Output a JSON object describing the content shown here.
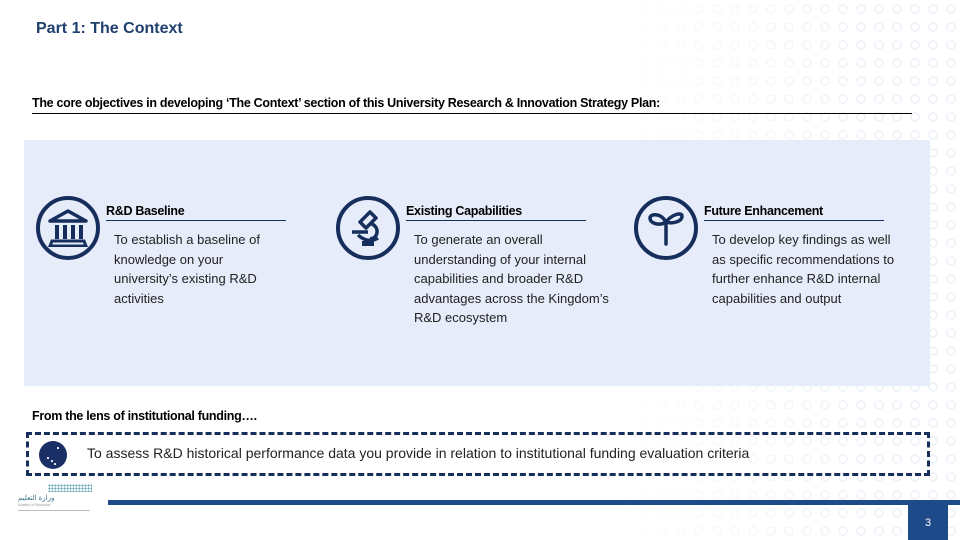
{
  "header": {
    "title": "Part 1: The Context",
    "subtitle": "The core objectives in developing ‘The Context’ section of this University Research & Innovation Strategy Plan:"
  },
  "objectives": [
    {
      "icon": "bank-building-icon",
      "heading": "R&D Baseline",
      "text": "To establish a baseline of knowledge on your university’s existing R&D activities"
    },
    {
      "icon": "microscope-icon",
      "heading": "Existing Capabilities",
      "text": "To generate an overall understanding of your internal capabilities and broader R&D advantages across the Kingdom’s R&D ecosystem"
    },
    {
      "icon": "sprout-icon",
      "heading": "Future Enhancement",
      "text": "To develop key findings as well as specific recommendations to further enhance R&D internal capabilities and output"
    }
  ],
  "funding": {
    "heading": "From the lens of institutional funding….",
    "icon": "galaxy-icon",
    "text": "To assess R&D historical performance data you provide in relation to institutional funding evaluation criteria"
  },
  "footer": {
    "page_number": "3",
    "logo_arabic": "وزارة التعليم",
    "logo_english": "Ministry of Education"
  },
  "colors": {
    "title": "#1f3f6e",
    "icon_navy": "#162e5c",
    "panel_bg": "#e6ecfa",
    "footer_blue": "#1f4a8a"
  }
}
